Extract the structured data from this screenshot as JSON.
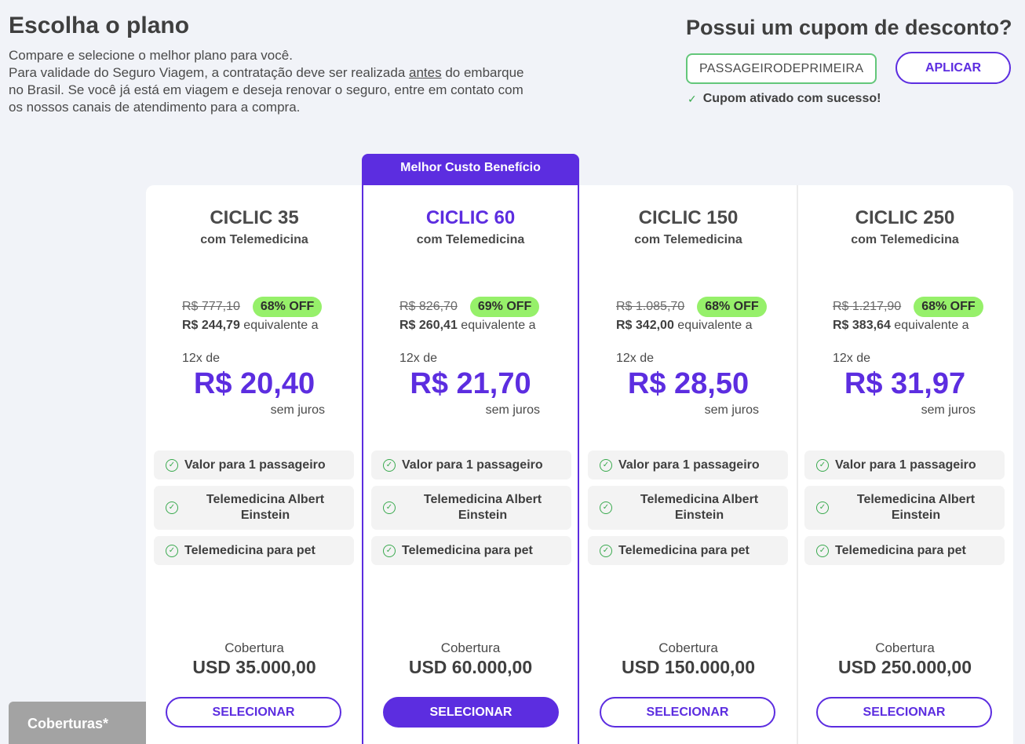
{
  "header": {
    "title": "Escolha o plano",
    "intro_line1": "Compare e selecione o melhor plano para você.",
    "intro_line2_pre": "Para validade do Seguro Viagem, a contratação deve ser realizada ",
    "intro_line2_underlined": "antes",
    "intro_line2_post": " do embarque no Brasil. Se você já está em viagem e deseja renovar o seguro, entre em contato com os nossos canais de atendimento para a compra."
  },
  "coupon": {
    "title": "Possui um cupom de desconto?",
    "value": "PASSAGEIRODEPRIMEIRA",
    "apply_label": "APLICAR",
    "success_message": "Cupom ativado com sucesso!"
  },
  "featured_ribbon": "Melhor Custo Benefício",
  "plans": [
    {
      "name": "CICLIC 35",
      "subtitle": "com Telemedicina",
      "old_price": "R$ 777,10",
      "discount": "68% OFF",
      "total": "R$ 244,79",
      "equiv_label": "equivalente a",
      "installments": "12x de",
      "installment_price": "R$ 20,40",
      "interest": "sem juros",
      "features": [
        "Valor para 1 passageiro",
        "Telemedicina Albert Einstein",
        "Telemedicina para pet"
      ],
      "coverage_label": "Cobertura",
      "coverage_value": "USD 35.000,00",
      "select_label": "SELECIONAR"
    },
    {
      "name": "CICLIC 60",
      "subtitle": "com Telemedicina",
      "old_price": "R$ 826,70",
      "discount": "69% OFF",
      "total": "R$ 260,41",
      "equiv_label": "equivalente a",
      "installments": "12x de",
      "installment_price": "R$ 21,70",
      "interest": "sem juros",
      "features": [
        "Valor para 1 passageiro",
        "Telemedicina Albert Einstein",
        "Telemedicina para pet"
      ],
      "coverage_label": "Cobertura",
      "coverage_value": "USD 60.000,00",
      "select_label": "SELECIONAR"
    },
    {
      "name": "CICLIC 150",
      "subtitle": "com Telemedicina",
      "old_price": "R$ 1.085,70",
      "discount": "68% OFF",
      "total": "R$ 342,00",
      "equiv_label": "equivalente a",
      "installments": "12x de",
      "installment_price": "R$ 28,50",
      "interest": "sem juros",
      "features": [
        "Valor para 1 passageiro",
        "Telemedicina Albert Einstein",
        "Telemedicina para pet"
      ],
      "coverage_label": "Cobertura",
      "coverage_value": "USD 150.000,00",
      "select_label": "SELECIONAR"
    },
    {
      "name": "CICLIC 250",
      "subtitle": "com Telemedicina",
      "old_price": "R$ 1.217,90",
      "discount": "68% OFF",
      "total": "R$ 383,64",
      "equiv_label": "equivalente a",
      "installments": "12x de",
      "installment_price": "R$ 31,97",
      "interest": "sem juros",
      "features": [
        "Valor para 1 passageiro",
        "Telemedicina Albert Einstein",
        "Telemedicina para pet"
      ],
      "coverage_label": "Cobertura",
      "coverage_value": "USD 250.000,00",
      "select_label": "SELECIONAR"
    }
  ],
  "coverage_tab": "Coberturas*",
  "colors": {
    "accent": "#5c2de0",
    "discount_badge": "#96f06a",
    "success": "#3aaa4f"
  }
}
